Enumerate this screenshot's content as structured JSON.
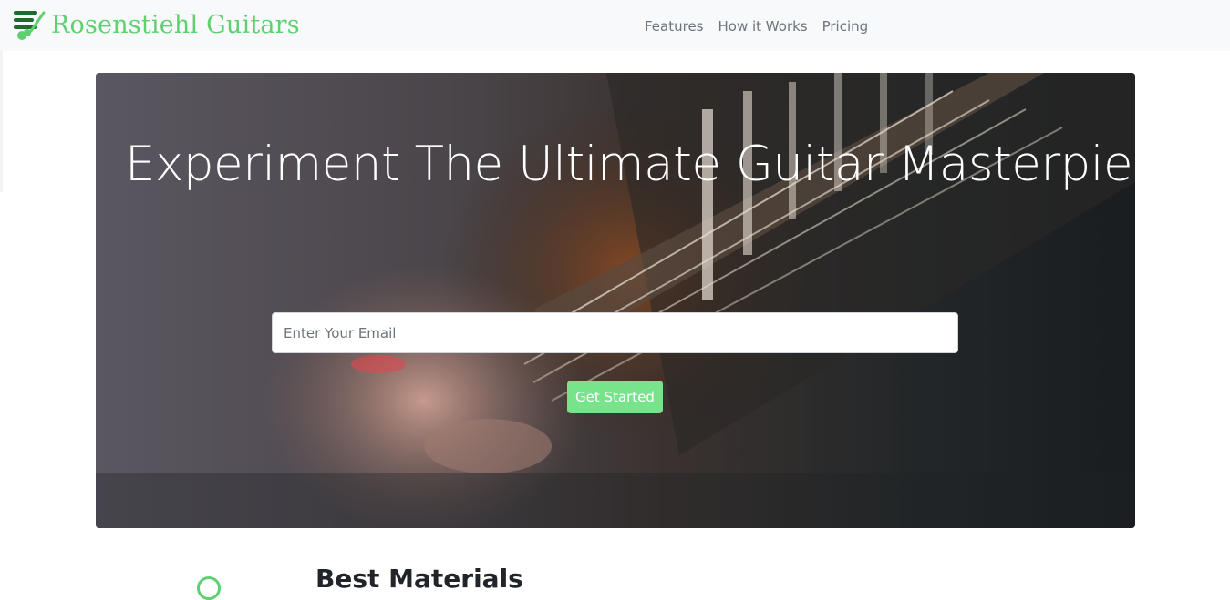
{
  "navbar": {
    "brand": "Rosenstiehl Guitars",
    "logo_icon": "guitar-menu-icon",
    "links": [
      "Features",
      "How it Works",
      "Pricing"
    ]
  },
  "hero": {
    "title": "Experiment The Ultimate Guitar Masterpiece",
    "email_placeholder": "Enter Your Email",
    "cta_label": "Get Started",
    "background_image": "guitar-playing-photo"
  },
  "features": {
    "first_title": "Best Materials",
    "first_icon": "circle-icon"
  },
  "colors": {
    "brand": "#5fd070",
    "cta": "#77e38b",
    "navbar_bg": "#f8f9fa",
    "nav_text": "#6c757d"
  }
}
